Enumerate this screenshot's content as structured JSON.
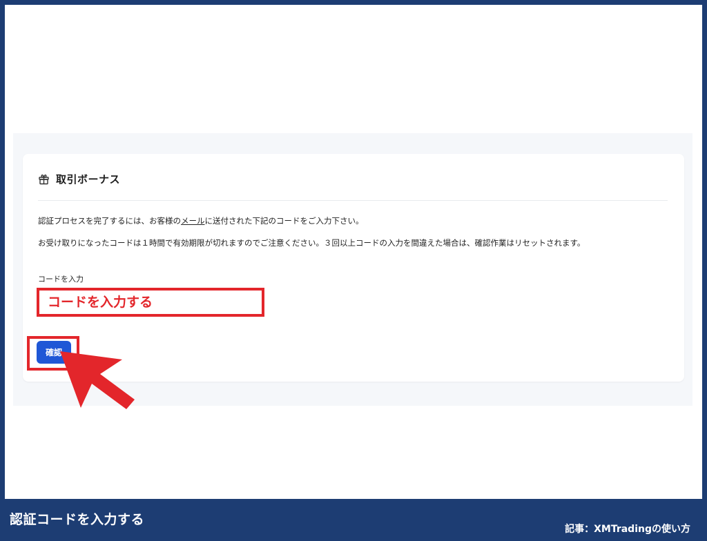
{
  "card": {
    "title": "取引ボーナス",
    "instruction_1_before": "認証プロセスを完了するには、お客様の",
    "instruction_1_link": "メール",
    "instruction_1_after": "に送付された下記のコードをご入力下さい。",
    "instruction_2": "お受け取りになったコードは１時間で有効期限が切れますのでご注意ください。３回以上コードの入力を間違えた場合は、確認作業はリセットされます。",
    "field_label": "コードを入力",
    "input_value": "",
    "input_placeholder": "コードを入力する",
    "confirm_label": "確認"
  },
  "footer": {
    "title": "認証コードを入力する",
    "credit": "記事：XMTradingの使い方"
  },
  "icons": {
    "header_icon": "gift-icon",
    "pointer": "arrow-pointer-icon"
  },
  "colors": {
    "frame": "#1d3d73",
    "highlight": "#e3262b",
    "button": "#1f57d6",
    "panel": "#f5f7fa"
  }
}
